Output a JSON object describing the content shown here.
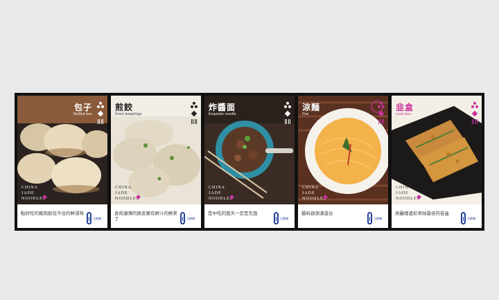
{
  "cards": [
    {
      "title_cn": "包子",
      "title_en": "Stuffed bun",
      "caption": "點好吃的豬肉餡包不住的鮮湯味",
      "brand_lines": [
        "CHINA",
        "JADE",
        "NOODLES"
      ],
      "colors": {
        "title": "#ffffff",
        "en": "#ffffff",
        "badge": "#ffffff",
        "brand": "#ffffff"
      }
    },
    {
      "title_cn": "煎餃",
      "title_en": "Fried dumplings",
      "caption": "香煎讓薄的餅皮裹有鮮汁的鮮美了",
      "brand_lines": [
        "CHINA",
        "JADE",
        "NOODLES"
      ],
      "colors": {
        "title": "#222222",
        "en": "#333333",
        "badge": "#222222",
        "brand": "#222222"
      }
    },
    {
      "title_cn": "炸醬面",
      "title_en": "Exquisite noodle",
      "caption": "是中吃的面天一定是先面",
      "brand_lines": [
        "CHINA",
        "JADE",
        "NOODLES"
      ],
      "colors": {
        "title": "#ffffff",
        "en": "#ffffff",
        "badge": "#ffffff",
        "brand": "#ffffff"
      }
    },
    {
      "title_cn": "涼麵",
      "title_en": "Flat",
      "caption": "醬料啟源漢還台",
      "brand_lines": [
        "CHINA",
        "JADE",
        "NOODLES"
      ],
      "colors": {
        "title": "#ffffff",
        "en": "#ffffff",
        "badge": "#c8329c",
        "brand": "#ffffff"
      }
    },
    {
      "title_cn": "韭盒",
      "title_en": "Leek box",
      "caption": "烘麗裡邊彩翠絲最佳的韭盒",
      "brand_lines": [
        "CHINA",
        "JADE",
        "NOODLES"
      ],
      "colors": {
        "title": "#c8329c",
        "en": "#c8329c",
        "badge": "#c8329c",
        "brand": "#333333"
      }
    }
  ],
  "logo_text": "王師傅",
  "accent": "#c8329c",
  "logo_color": "#23409a"
}
